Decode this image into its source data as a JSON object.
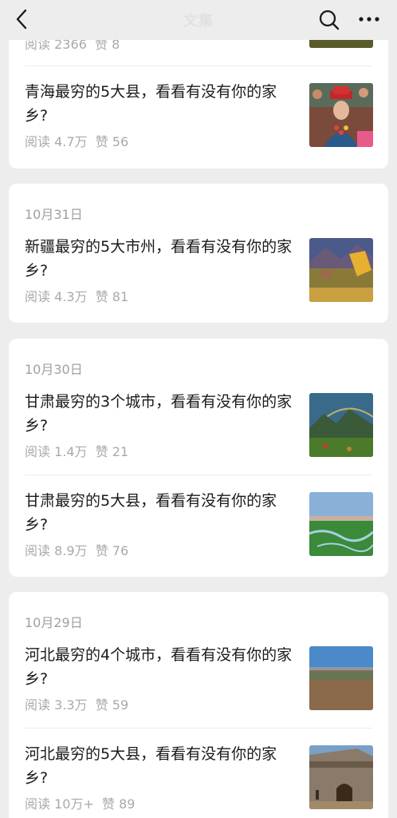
{
  "header": {
    "title": "文集"
  },
  "partial_top": {
    "meta": "阅读 2366  赞 8"
  },
  "groups": [
    {
      "items": [
        {
          "title": "青海最穷的5大县，看看有没有你的家乡?",
          "meta": "阅读 4.7万  赞 56",
          "thumb": "person-festival-image"
        }
      ]
    },
    {
      "date": "10月31日",
      "items": [
        {
          "title": "新疆最穷的5大市州，看看有没有你的家乡?",
          "meta": "阅读 4.3万  赞 81",
          "thumb": "autumn-village-image"
        }
      ]
    },
    {
      "date": "10月30日",
      "items": [
        {
          "title": "甘肃最穷的3个城市，看看有没有你的家乡?",
          "meta": "阅读 1.4万  赞 21",
          "thumb": "mountain-rainbow-image"
        },
        {
          "title": "甘肃最穷的5大县，看看有没有你的家乡?",
          "meta": "阅读 8.9万  赞 76",
          "thumb": "grassland-river-image"
        }
      ]
    },
    {
      "date": "10月29日",
      "items": [
        {
          "title": "河北最穷的4个城市，看看有没有你的家乡?",
          "meta": "阅读 3.3万  赞 59",
          "thumb": "river-city-image"
        },
        {
          "title": "河北最穷的5大县，看看有没有你的家乡?",
          "meta": "阅读 10万+  赞 89",
          "thumb": "ancient-wall-image"
        }
      ]
    }
  ]
}
